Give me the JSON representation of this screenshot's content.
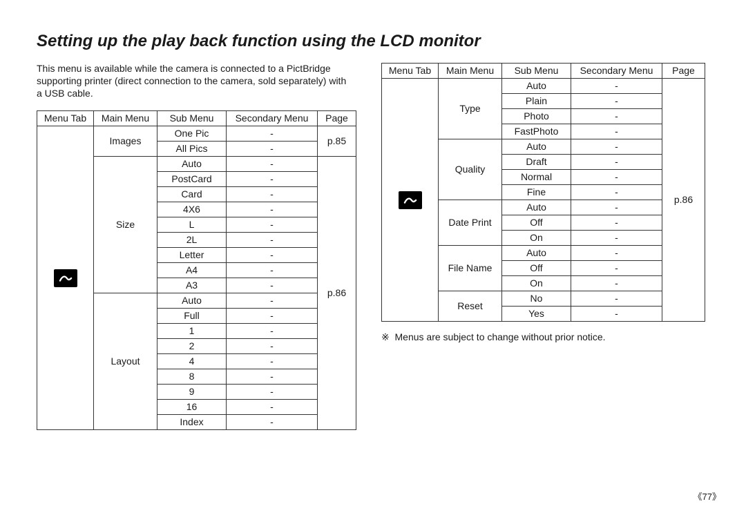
{
  "title": "Setting up the play back function using the LCD monitor",
  "intro": "This menu is available while the camera is connected to a PictBridge supporting printer (direct connection to the camera, sold separately) with a USB cable.",
  "headers": {
    "menu_tab": "Menu Tab",
    "main_menu": "Main Menu",
    "sub_menu": "Sub Menu",
    "secondary_menu": "Secondary Menu",
    "page": "Page"
  },
  "table_left": {
    "icon_name": "pictbridge-icon",
    "page_images": "p.85",
    "page_rest": "p.86",
    "groups": [
      {
        "main": "Images",
        "subs": [
          "One Pic",
          "All Pics"
        ]
      },
      {
        "main": "Size",
        "subs": [
          "Auto",
          "PostCard",
          "Card",
          "4X6",
          "L",
          "2L",
          "Letter",
          "A4",
          "A3"
        ]
      },
      {
        "main": "Layout",
        "subs": [
          "Auto",
          "Full",
          "1",
          "2",
          "4",
          "8",
          "9",
          "16",
          "Index"
        ]
      }
    ]
  },
  "table_right": {
    "icon_name": "pictbridge-icon",
    "page_all": "p.86",
    "groups": [
      {
        "main": "Type",
        "subs": [
          "Auto",
          "Plain",
          "Photo",
          "FastPhoto"
        ]
      },
      {
        "main": "Quality",
        "subs": [
          "Auto",
          "Draft",
          "Normal",
          "Fine"
        ]
      },
      {
        "main": "Date Print",
        "subs": [
          "Auto",
          "Off",
          "On"
        ]
      },
      {
        "main": "File Name",
        "subs": [
          "Auto",
          "Off",
          "On"
        ]
      },
      {
        "main": "Reset",
        "subs": [
          "No",
          "Yes"
        ]
      }
    ]
  },
  "footnote_symbol": "※",
  "footnote": "Menus are subject to change without prior notice.",
  "page_number": "《77》",
  "dash": "-"
}
